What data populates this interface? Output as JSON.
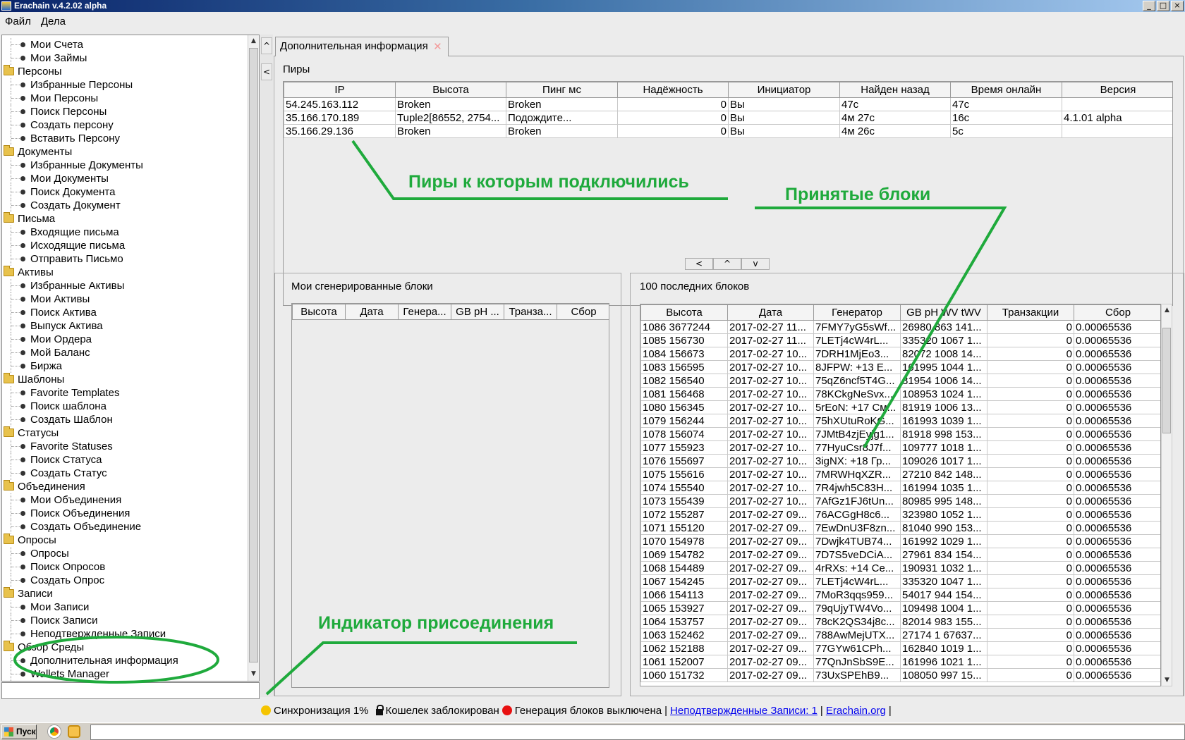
{
  "window": {
    "title": "Erachain v.4.2.02 alpha"
  },
  "menu": [
    "Файл",
    "Дела"
  ],
  "tree": [
    {
      "type": "leaf",
      "label": "Мои Счета"
    },
    {
      "type": "leaf",
      "label": "Мои Займы"
    },
    {
      "type": "folder",
      "label": "Персоны"
    },
    {
      "type": "leaf",
      "label": "Избранные Персоны"
    },
    {
      "type": "leaf",
      "label": "Мои Персоны"
    },
    {
      "type": "leaf",
      "label": "Поиск Персоны"
    },
    {
      "type": "leaf",
      "label": "Создать персону"
    },
    {
      "type": "leaf",
      "label": "Вставить Персону"
    },
    {
      "type": "folder",
      "label": "Документы"
    },
    {
      "type": "leaf",
      "label": "Избранные Документы"
    },
    {
      "type": "leaf",
      "label": "Мои Документы"
    },
    {
      "type": "leaf",
      "label": "Поиск Документа"
    },
    {
      "type": "leaf",
      "label": "Создать Документ"
    },
    {
      "type": "folder",
      "label": "Письма"
    },
    {
      "type": "leaf",
      "label": "Входящие письма"
    },
    {
      "type": "leaf",
      "label": "Исходящие письма"
    },
    {
      "type": "leaf",
      "label": "Отправить Письмо"
    },
    {
      "type": "folder",
      "label": "Активы"
    },
    {
      "type": "leaf",
      "label": "Избранные Активы"
    },
    {
      "type": "leaf",
      "label": "Мои Активы"
    },
    {
      "type": "leaf",
      "label": "Поиск Актива"
    },
    {
      "type": "leaf",
      "label": "Выпуск Актива"
    },
    {
      "type": "leaf",
      "label": "Мои Ордера"
    },
    {
      "type": "leaf",
      "label": "Мой Баланс"
    },
    {
      "type": "leaf",
      "label": "Биржа"
    },
    {
      "type": "folder",
      "label": "Шаблоны"
    },
    {
      "type": "leaf",
      "label": "Favorite Templates"
    },
    {
      "type": "leaf",
      "label": "Поиск шаблона"
    },
    {
      "type": "leaf",
      "label": "Создать Шаблон"
    },
    {
      "type": "folder",
      "label": "Статусы"
    },
    {
      "type": "leaf",
      "label": "Favorite Statuses"
    },
    {
      "type": "leaf",
      "label": "Поиск Статуса"
    },
    {
      "type": "leaf",
      "label": "Создать Статус"
    },
    {
      "type": "folder",
      "label": "Объединения"
    },
    {
      "type": "leaf",
      "label": "Мои Объединения"
    },
    {
      "type": "leaf",
      "label": "Поиск Объединения"
    },
    {
      "type": "leaf",
      "label": "Создать Объединение"
    },
    {
      "type": "folder",
      "label": "Опросы"
    },
    {
      "type": "leaf",
      "label": "Опросы"
    },
    {
      "type": "leaf",
      "label": "Поиск Опросов"
    },
    {
      "type": "leaf",
      "label": "Создать Опрос"
    },
    {
      "type": "folder",
      "label": "Записи"
    },
    {
      "type": "leaf",
      "label": "Мои Записи"
    },
    {
      "type": "leaf",
      "label": "Поиск Записи"
    },
    {
      "type": "leaf",
      "label": "Неподтвержденные Записи"
    },
    {
      "type": "folder",
      "label": "Обзор Среды"
    },
    {
      "type": "leaf",
      "label": "Дополнительная информация"
    },
    {
      "type": "leaf",
      "label": "Wallets Manager"
    }
  ],
  "splitter": {
    "up": "^",
    "left": "<"
  },
  "tab": {
    "label": "Дополнительная информация"
  },
  "peers": {
    "title": "Пиры",
    "columns": [
      "IP",
      "Высота",
      "Пинг мс",
      "Надёжность",
      "Инициатор",
      "Найден назад",
      "Время онлайн",
      "Версия"
    ],
    "rows": [
      [
        "54.245.163.112",
        "Broken",
        "Broken",
        "0",
        "Вы",
        "47с",
        "47с",
        ""
      ],
      [
        "35.166.170.189",
        "Tuple2[86552, 2754...",
        "Подождите...",
        "0",
        "Вы",
        "4м 27с",
        "16с",
        "4.1.01 alpha"
      ],
      [
        "35.166.29.136",
        "Broken",
        "Broken",
        "0",
        "Вы",
        "4м 26с",
        "5с",
        ""
      ]
    ]
  },
  "mid_buttons": [
    "<",
    "^",
    "v"
  ],
  "my_blocks": {
    "title": "Мои сгенерированные блоки",
    "columns": [
      "Высота",
      "Дата",
      "Генера...",
      "GB pH ...",
      "Транза...",
      "Сбор"
    ]
  },
  "last_blocks": {
    "title": "100 последних блоков",
    "columns": [
      "Высота",
      "Дата",
      "Генератор",
      "GB pH WV tWV",
      "Транзакции",
      "Сбор"
    ],
    "rows": [
      [
        "1086 3677244",
        "2017-02-27 11...",
        "7FMY7yG5sWf...",
        "26980 863 141...",
        "0",
        "0.00065536"
      ],
      [
        "1085 156730",
        "2017-02-27 11...",
        "7LETj4cW4rL...",
        "335320 1067 1...",
        "0",
        "0.00065536"
      ],
      [
        "1084 156673",
        "2017-02-27 10...",
        "7DRH1MjEo3...",
        "82072 1008 14...",
        "0",
        "0.00065536"
      ],
      [
        "1083 156595",
        "2017-02-27 10...",
        "8JFPW: +13 E...",
        "161995 1044 1...",
        "0",
        "0.00065536"
      ],
      [
        "1082 156540",
        "2017-02-27 10...",
        "75qZ6ncf5T4G...",
        "81954 1006 14...",
        "0",
        "0.00065536"
      ],
      [
        "1081 156468",
        "2017-02-27 10...",
        "78KCkgNeSvx...",
        "108953 1024 1...",
        "0",
        "0.00065536"
      ],
      [
        "1080 156345",
        "2017-02-27 10...",
        "5rEoN: +17 См...",
        "81919 1006 13...",
        "0",
        "0.00065536"
      ],
      [
        "1079 156244",
        "2017-02-27 10...",
        "75hXUtuRoKG...",
        "161993 1039 1...",
        "0",
        "0.00065536"
      ],
      [
        "1078 156074",
        "2017-02-27 10...",
        "7JMtB4zjEyjg1...",
        "81918 998 153...",
        "0",
        "0.00065536"
      ],
      [
        "1077 155923",
        "2017-02-27 10...",
        "77HyuCsr8J7f...",
        "109777 1018 1...",
        "0",
        "0.00065536"
      ],
      [
        "1076 155697",
        "2017-02-27 10...",
        "3igNX: +18 Гр...",
        "109026 1017 1...",
        "0",
        "0.00065536"
      ],
      [
        "1075 155616",
        "2017-02-27 10...",
        "7MRWHqXZR...",
        "27210 842 148...",
        "0",
        "0.00065536"
      ],
      [
        "1074 155540",
        "2017-02-27 10...",
        "7R4jwh5C83H...",
        "161994 1035 1...",
        "0",
        "0.00065536"
      ],
      [
        "1073 155439",
        "2017-02-27 10...",
        "7AfGz1FJ6tUn...",
        "80985 995 148...",
        "0",
        "0.00065536"
      ],
      [
        "1072 155287",
        "2017-02-27 09...",
        "76ACGgH8c6...",
        "323980 1052 1...",
        "0",
        "0.00065536"
      ],
      [
        "1071 155120",
        "2017-02-27 09...",
        "7EwDnU3F8zn...",
        "81040 990 153...",
        "0",
        "0.00065536"
      ],
      [
        "1070 154978",
        "2017-02-27 09...",
        "7Dwjk4TUB74...",
        "161992 1029 1...",
        "0",
        "0.00065536"
      ],
      [
        "1069 154782",
        "2017-02-27 09...",
        "7D7S5veDCiA...",
        "27961 834 154...",
        "0",
        "0.00065536"
      ],
      [
        "1068 154489",
        "2017-02-27 09...",
        "4rRXs: +14 Се...",
        "190931 1032 1...",
        "0",
        "0.00065536"
      ],
      [
        "1067 154245",
        "2017-02-27 09...",
        "7LETj4cW4rL...",
        "335320 1047 1...",
        "0",
        "0.00065536"
      ],
      [
        "1066 154113",
        "2017-02-27 09...",
        "7MoR3qqs959...",
        "54017 944 154...",
        "0",
        "0.00065536"
      ],
      [
        "1065 153927",
        "2017-02-27 09...",
        "79qUjyTW4Vo...",
        "109498 1004 1...",
        "0",
        "0.00065536"
      ],
      [
        "1064 153757",
        "2017-02-27 09...",
        "78cK2QS34j8c...",
        "82014 983 155...",
        "0",
        "0.00065536"
      ],
      [
        "1063 152462",
        "2017-02-27 09...",
        "788AwMejUTX...",
        "27174 1 67637...",
        "0",
        "0.00065536"
      ],
      [
        "1062 152188",
        "2017-02-27 09...",
        "77GYw61CPh...",
        "162840 1019 1...",
        "0",
        "0.00065536"
      ],
      [
        "1061 152007",
        "2017-02-27 09...",
        "77QnJnSbS9E...",
        "161996 1021 1...",
        "0",
        "0.00065536"
      ],
      [
        "1060 151732",
        "2017-02-27 09...",
        "73UxSPEhB9...",
        "108050 997 15...",
        "0",
        "0.00065536"
      ]
    ]
  },
  "annotations": {
    "peers": "Пиры к которым подключились",
    "blocks": "Принятые блоки",
    "indicator": "Индикатор присоединения"
  },
  "status": {
    "sync": "Синхронизация 1%",
    "wallet": "Кошелек заблокирован",
    "generation": "Генерация блоков выключена",
    "sep": "|",
    "unconfirmed": "Неподтвержденные Записи: 1",
    "site": "Erachain.org"
  },
  "colors": {
    "annotation": "#1faa3c",
    "sync_dot": "#f5c400",
    "gen_dot": "#e81010"
  },
  "taskbar": {
    "start": "Пуск"
  }
}
